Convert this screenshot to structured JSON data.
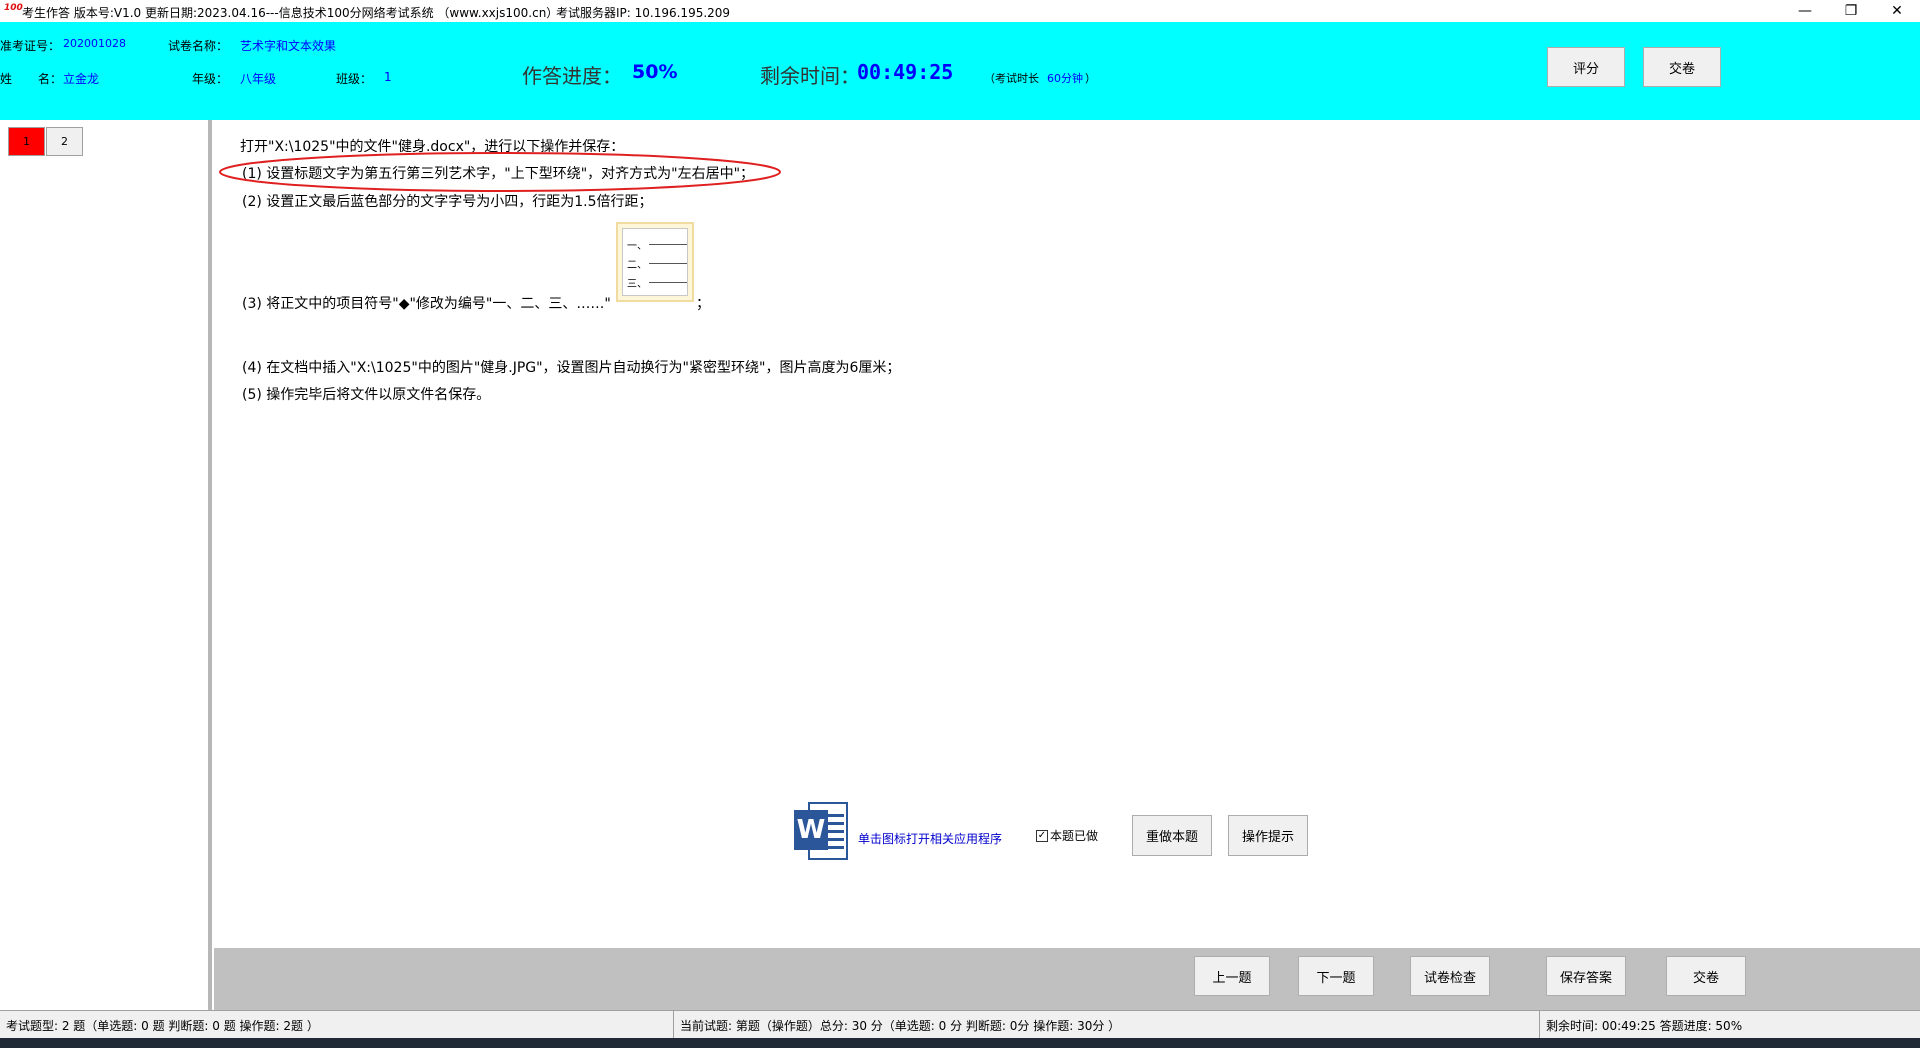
{
  "titlebar": {
    "logo_text": "100",
    "app_info": "考生作答 版本号:V1.0 更新日期:2023.04.16---信息技术100分网络考试系统 （www.xxjs100.cn）",
    "server_label": "考试服务器IP: 10.196.195.209",
    "minimize": "—",
    "restore": "❐",
    "close": "✕"
  },
  "header": {
    "exam_id_label": "准考证号：",
    "exam_id": "202001028",
    "paper_label": "试卷名称：",
    "paper_name": "艺术字和文本效果",
    "name_label_1": "姓",
    "name_label_2": "名：",
    "name": "立金龙",
    "grade_label": "年级：",
    "grade": "八年级",
    "class_label": "班级：",
    "class": "1",
    "progress_label": "作答进度：",
    "progress_value": "50%",
    "progress_fraction": 0.5,
    "time_label": "剩余时间：",
    "time_value": "00:49:25",
    "duration_prefix": "（考试时长",
    "duration_value": "60分钟",
    "duration_suffix": "）",
    "score_button": "评分",
    "submit_button": "交卷"
  },
  "questions": {
    "items": [
      "1",
      "2"
    ],
    "current": "1",
    "current_color": "#ff0000"
  },
  "task": {
    "intro": "打开\"X:\\1025\"中的文件\"健身.docx\"，进行以下操作并保存：",
    "step1": "(1) 设置标题文字为第五行第三列艺术字，\"上下型环绕\"，对齐方式为\"左右居中\"；",
    "step2": "(2) 设置正文最后蓝色部分的文字字号为小四，行距为1.5倍行距；",
    "step3_prefix": "(3) 将正文中的项目符号\"◆\"修改为编号\"一、二、三、……\"",
    "step3_suffix": "；",
    "numbering_preview": [
      "一、",
      "二、",
      "三、"
    ],
    "step4": "(4) 在文档中插入\"X:\\1025\"中的图片\"健身.JPG\"，设置图片自动换行为\"紧密型环绕\"，图片高度为6厘米；",
    "step5": "(5) 操作完毕后将文件以原文件名保存。"
  },
  "actions": {
    "word_icon_letter": "W",
    "open_app_link": "单击图标打开相关应用程序",
    "done_checkbox_label": "本题已做",
    "redo_button": "重做本题",
    "hint_button": "操作提示"
  },
  "nav": {
    "prev": "上一题",
    "next": "下一题",
    "check": "试卷检查",
    "save": "保存答案",
    "submit": "交卷"
  },
  "statusbar": {
    "types": "考试题型: 2 题（单选题: 0 题 判断题: 0 题 操作题: 2题 ）",
    "current": "当前试题: 第题（操作题）总分: 30 分（单选题: 0 分 判断题: 0分 操作题: 30分 ）",
    "remaining": "剩余时间: 00:49:25 答题进度: 50%"
  },
  "colors": {
    "header_bg": "#00ffff",
    "accent_blue": "#0000ff",
    "annotation_red": "#e02020"
  }
}
